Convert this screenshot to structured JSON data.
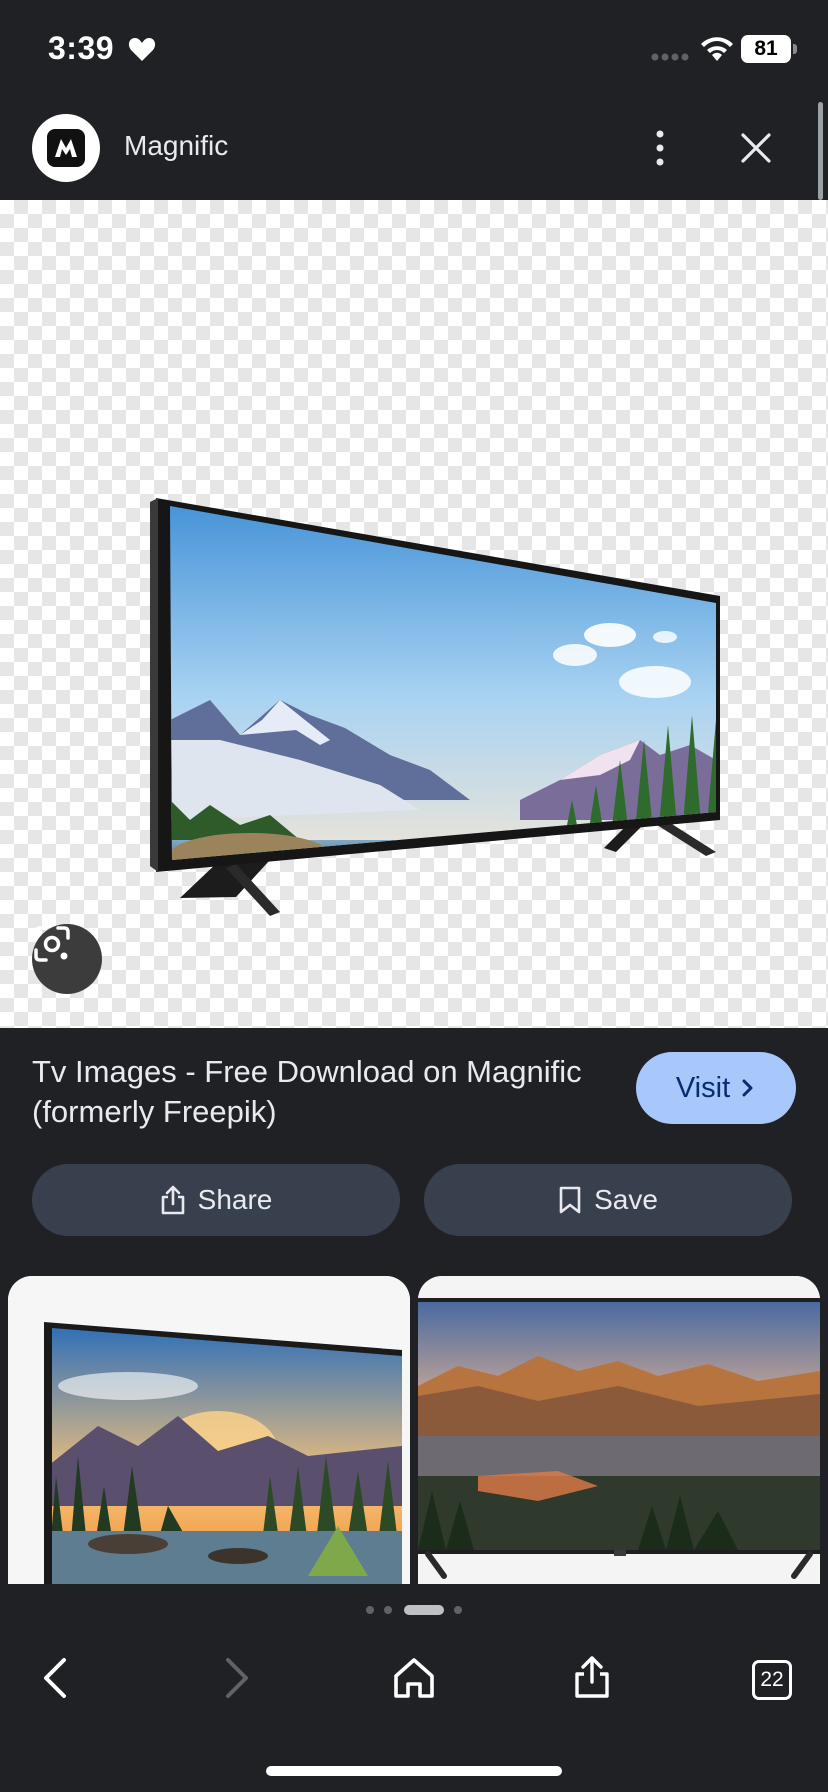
{
  "status_bar": {
    "time": "3:39",
    "battery": "81"
  },
  "header": {
    "site_name": "Magnific",
    "logo_icon": "magnific-logo",
    "more_icon": "more-vert-icon",
    "close_icon": "close-icon"
  },
  "main_image": {
    "alt": "TV with mountain lake landscape on screen",
    "lens_icon": "google-lens-icon"
  },
  "result": {
    "title": "Tv Images - Free Download on Magnific (formerly Freepik)",
    "visit_label": "Visit",
    "share_label": "Share",
    "save_label": "Save"
  },
  "related": [
    {
      "alt": "TV with forest sunset scene"
    },
    {
      "alt": "TV with mountain lake sunset scene"
    }
  ],
  "bottom_nav": {
    "tabs_count": "22",
    "back_icon": "back-icon",
    "forward_icon": "forward-icon",
    "home_icon": "home-icon",
    "share_icon": "share-icon",
    "tabs_icon": "tabs-icon"
  },
  "colors": {
    "background": "#202124",
    "visit_button": "#a8c7fa",
    "action_button": "#38404e"
  }
}
